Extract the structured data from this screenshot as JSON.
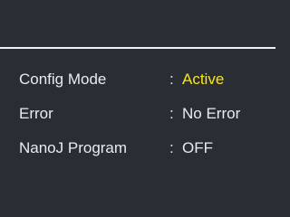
{
  "status_panel": {
    "separator": ":",
    "accent_color": "#f7e51b",
    "rows": [
      {
        "label": "Config Mode",
        "value": "Active"
      },
      {
        "label": "Error",
        "value": "No Error"
      },
      {
        "label": "NanoJ Program",
        "value": "OFF"
      }
    ]
  }
}
